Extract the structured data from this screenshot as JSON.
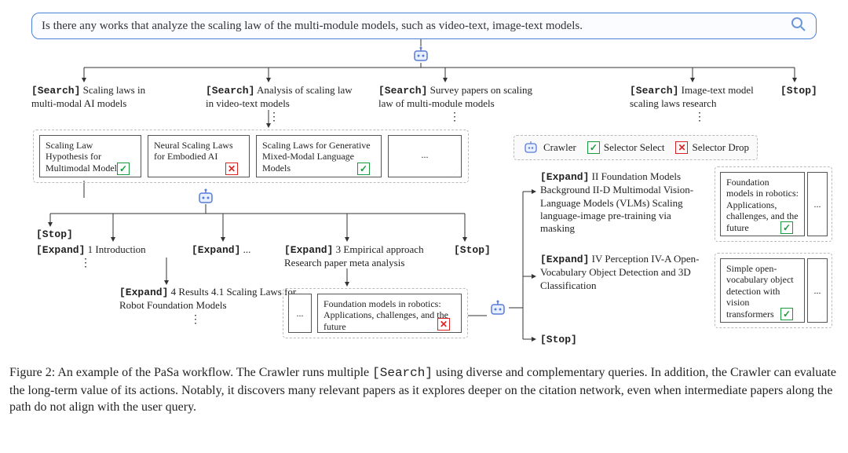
{
  "search_query": "Is there any works that analyze the scaling law of the multi-module models, such as video-text, image-text models.",
  "legend": {
    "crawler": "Crawler",
    "select": "Selector Select",
    "drop": "Selector Drop"
  },
  "top_actions": {
    "a1_tag": "[Search]",
    "a1_text": " Scaling laws in multi-modal AI models",
    "a2_tag": "[Search]",
    "a2_text": " Analysis of scaling law in video-text models",
    "a3_tag": "[Search]",
    "a3_text": " Survey papers on scaling law of multi-module models",
    "a4_tag": "[Search]",
    "a4_text": " Image-text model scaling laws research",
    "a5_tag": "[Stop]"
  },
  "papers_row1": {
    "p1": "Scaling Law Hypothesis for Multimodal Model",
    "p2": "Neural Scaling Laws for Embodied AI",
    "p3": "Scaling Laws for Generative Mixed-Modal Language Models",
    "p4": "..."
  },
  "mid_actions": {
    "stop": "[Stop]",
    "e1_tag": "[Expand]",
    "e1_text": " 1 Introduction",
    "e2_tag": "[Expand]",
    "e2_text": " ...",
    "e3_tag": "[Expand]",
    "e3_text": " 3 Empirical approach Research paper meta analysis",
    "stop2": "[Stop]"
  },
  "lower_left": {
    "e4_tag": "[Expand]",
    "e4_text": " 4 Results 4.1 Scaling Laws for Robot Foundation Models",
    "p_dot": "...",
    "p5": "Foundation models in robotics: Applications, challenges, and the future"
  },
  "right_expand": {
    "r1_tag": "[Expand]",
    "r1_text": " II Foundation Models Background II-D Multimodal Vision-Language Models (VLMs) Scaling language-image pre-training via masking",
    "r2_tag": "[Expand]",
    "r2_text": " IV Perception IV-A Open-Vocabulary Object Detection and 3D Classification",
    "r3": "[Stop]",
    "rp1": "Foundation models in robotics: Applications, challenges, and the future",
    "rp2": "Simple open-vocabulary object detection with vision transformers"
  },
  "caption": {
    "label": "Figure 2:",
    "body_a": " An example of the PaSa workflow. The Crawler runs multiple ",
    "code": "[Search]",
    "body_b": " using diverse and complementary queries. In addition, the Crawler can evaluate the long-term value of its actions. Notably, it discovers many relevant papers as it explores deeper on the citation network, even when intermediate papers along the path do not align with the user query."
  }
}
